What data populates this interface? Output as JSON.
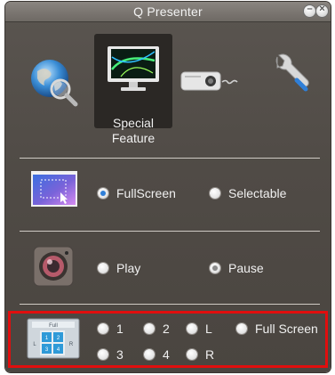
{
  "window": {
    "title": "Q Presenter"
  },
  "toolbar": {
    "caption_line1": "Special",
    "caption_line2": "Feature",
    "icons": [
      "globe-icon",
      "monitor-icon",
      "projector-icon",
      "wrench-icon"
    ]
  },
  "fullscreen_row": {
    "icon": "screen-area-icon",
    "options": [
      {
        "label": "FullScreen",
        "checked": true
      },
      {
        "label": "Selectable",
        "checked": false
      }
    ]
  },
  "playback_row": {
    "icon": "camera-lens-icon",
    "options": [
      {
        "label": "Play",
        "checked": false
      },
      {
        "label": "Pause",
        "checked": true
      }
    ]
  },
  "split_row": {
    "icon": "split-screen-icon",
    "icon_text": {
      "top": "Full",
      "left": "L",
      "right": "R",
      "cells": [
        "1",
        "2",
        "3",
        "4"
      ]
    },
    "options": [
      {
        "label": "1"
      },
      {
        "label": "2"
      },
      {
        "label": "L"
      },
      {
        "label": "Full Screen"
      },
      {
        "label": "3"
      },
      {
        "label": "4"
      },
      {
        "label": "R"
      }
    ]
  },
  "colors": {
    "accent_blue": "#2f7fd8",
    "highlight_red": "#e10e0e",
    "panel_bg": "#504b46"
  }
}
